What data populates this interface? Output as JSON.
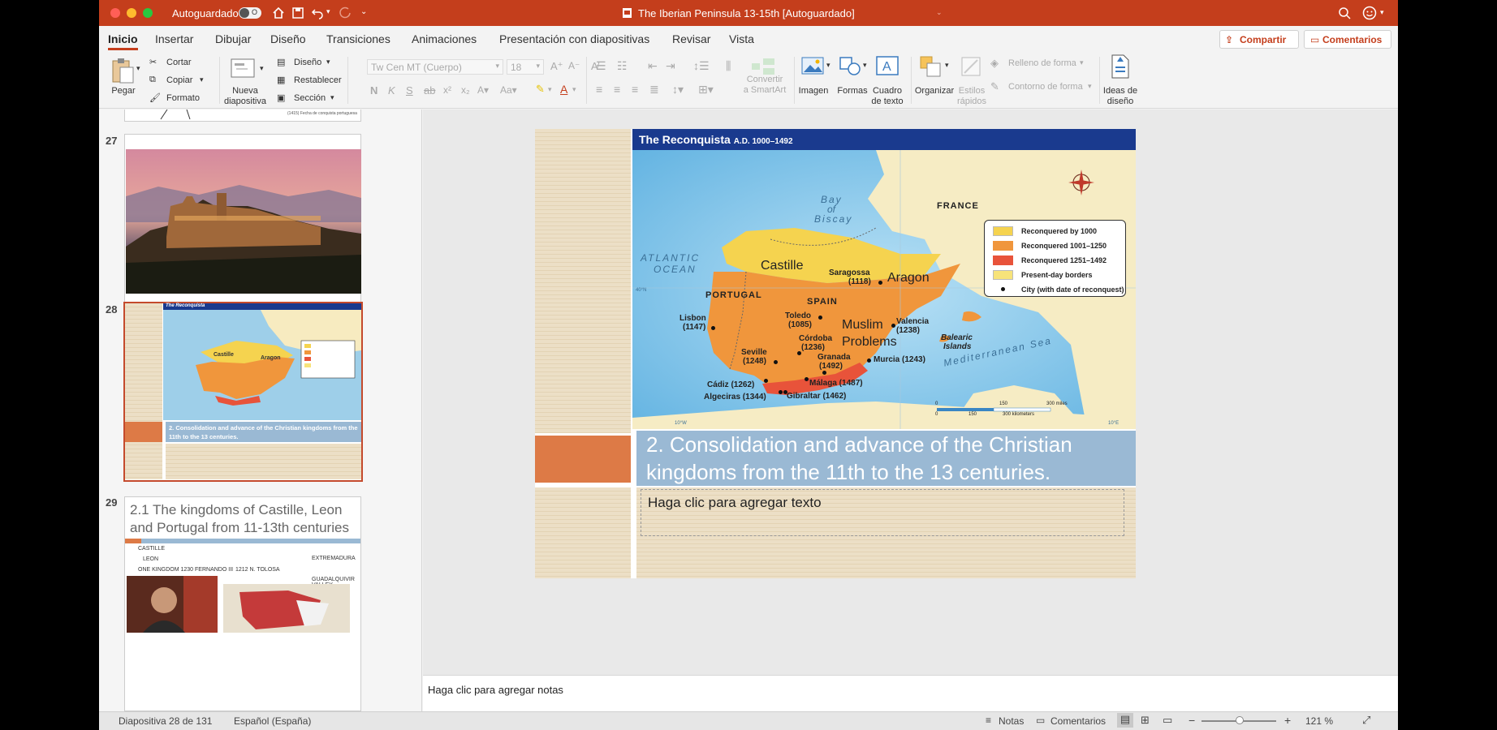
{
  "window": {
    "title": "The Iberian Peninsula 13-15th [Autoguardado]",
    "autosave_label": "Autoguardado",
    "autosave_state": "O"
  },
  "tabs": [
    "Inicio",
    "Insertar",
    "Dibujar",
    "Diseño",
    "Transiciones",
    "Animaciones",
    "Presentación con diapositivas",
    "Revisar",
    "Vista"
  ],
  "share_label": "Compartir",
  "comments_label": "Comentarios",
  "ribbon": {
    "paste": "Pegar",
    "cut": "Cortar",
    "copy": "Copiar",
    "format": "Formato",
    "new_slide_1": "Nueva",
    "new_slide_2": "diapositiva",
    "layout": "Diseño",
    "reset": "Restablecer",
    "section": "Sección",
    "font_name": "Tw Cen MT (Cuerpo)",
    "font_size": "18",
    "convert_1": "Convertir",
    "convert_2": "a SmartArt",
    "image": "Imagen",
    "shapes": "Formas",
    "textbox_1": "Cuadro",
    "textbox_2": "de texto",
    "arrange": "Organizar",
    "quick_styles_1": "Estilos",
    "quick_styles_2": "rápidos",
    "shape_fill": "Relleno de forma",
    "shape_outline": "Contorno de forma",
    "design_ideas_1": "Ideas de",
    "design_ideas_2": "diseño"
  },
  "thumbs": {
    "top_caption": "(1415) Fecha de conquista portuguesa",
    "s27_num": "27",
    "s28_num": "28",
    "s29_num": "29",
    "s28_title": "2. Consolidation and advance of the Christian kingdoms from the 11th to the 13 centuries.",
    "s29_title": "2.1 The kingdoms of Castille, Leon and Portugal from 11-13th centuries",
    "s29_b1": "CASTILLE",
    "s29_b2": "LEON",
    "s29_b3": "ONE KINGDOM 1230 FERNANDO III",
    "s29_b3b": "1212 N. TOLOSA",
    "s29_b4": "EXTREMADURA",
    "s29_b5": "GUADALQUIVIR VALLEY"
  },
  "slide": {
    "map_title": "The Reconquista",
    "map_dates": "A.D. 1000–1492",
    "legend": [
      "Reconquered by 1000",
      "Reconquered 1001–1250",
      "Reconquered 1251–1492",
      "Present-day borders",
      "City (with date of reconquest)"
    ],
    "legend_colors": [
      "#f5d34f",
      "#f0963c",
      "#e8533a",
      "#f7e37a"
    ],
    "labels": {
      "bay": "Bay",
      "of": "of",
      "biscay": "Biscay",
      "france": "FRANCE",
      "atlantic": "ATLANTIC",
      "ocean": "OCEAN",
      "castille": "Castille",
      "saragossa": "Saragossa",
      "saragossa_d": "(1118)",
      "aragon": "Aragon",
      "portugal": "PORTUGAL",
      "spain": "SPAIN",
      "lisbon": "Lisbon",
      "lisbon_d": "(1147)",
      "toledo": "Toledo",
      "toledo_d": "(1085)",
      "muslim": "Muslim",
      "problems": "Problems",
      "valencia": "Valencia",
      "valencia_d": "(1238)",
      "cordoba": "Córdoba",
      "cordoba_d": "(1236)",
      "seville": "Seville",
      "seville_d": "(1248)",
      "granada": "Granada",
      "granada_d": "(1492)",
      "murcia": "Murcia (1243)",
      "balearic": "Balearic",
      "islands": "Islands",
      "med": "Mediterranean Sea",
      "cadiz": "Cádiz (1262)",
      "malaga": "Málaga (1487)",
      "algeciras": "Algeciras (1344)",
      "gibraltar": "Gibraltar (1462)",
      "sc0": "0",
      "sc150": "150",
      "sc300m": "300 miles",
      "sc300k": "300 kilometers",
      "lon10w": "10°W",
      "lon10e": "10°E",
      "lat40": "40°N"
    },
    "heading": "2. Consolidation and advance of the Christian kingdoms from the 11th to the 13 centuries.",
    "body_placeholder": "Haga clic para agregar texto"
  },
  "notes_placeholder": "Haga clic para agregar notas",
  "status": {
    "slide_info": "Diapositiva 28 de 131",
    "language": "Español (España)",
    "notes": "Notas",
    "comments": "Comentarios",
    "zoom": "121 %"
  }
}
